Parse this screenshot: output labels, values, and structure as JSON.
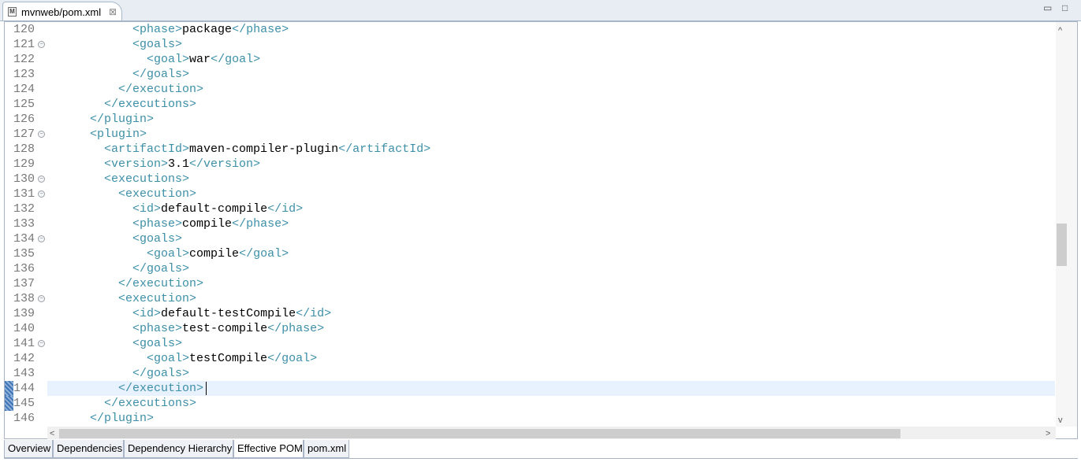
{
  "editor_tab": {
    "icon_letter": "M",
    "title": "mvnweb/pom.xml",
    "close": "⊠"
  },
  "window_controls": {
    "minimize": "▭",
    "maximize": "□"
  },
  "lines": [
    {
      "num": "120",
      "fold": false,
      "indent": 6,
      "segs": [
        [
          "t",
          "<phase>"
        ],
        [
          "x",
          "package"
        ],
        [
          "t",
          "</phase>"
        ]
      ]
    },
    {
      "num": "121",
      "fold": true,
      "indent": 6,
      "segs": [
        [
          "t",
          "<goals>"
        ]
      ]
    },
    {
      "num": "122",
      "fold": false,
      "indent": 7,
      "segs": [
        [
          "t",
          "<goal>"
        ],
        [
          "x",
          "war"
        ],
        [
          "t",
          "</goal>"
        ]
      ]
    },
    {
      "num": "123",
      "fold": false,
      "indent": 6,
      "segs": [
        [
          "t",
          "</goals>"
        ]
      ]
    },
    {
      "num": "124",
      "fold": false,
      "indent": 5,
      "segs": [
        [
          "t",
          "</execution>"
        ]
      ]
    },
    {
      "num": "125",
      "fold": false,
      "indent": 4,
      "segs": [
        [
          "t",
          "</executions>"
        ]
      ]
    },
    {
      "num": "126",
      "fold": false,
      "indent": 3,
      "segs": [
        [
          "t",
          "</plugin>"
        ]
      ]
    },
    {
      "num": "127",
      "fold": true,
      "indent": 3,
      "segs": [
        [
          "t",
          "<plugin>"
        ]
      ]
    },
    {
      "num": "128",
      "fold": false,
      "indent": 4,
      "segs": [
        [
          "t",
          "<artifactId>"
        ],
        [
          "x",
          "maven-compiler-plugin"
        ],
        [
          "t",
          "</artifactId>"
        ]
      ]
    },
    {
      "num": "129",
      "fold": false,
      "indent": 4,
      "segs": [
        [
          "t",
          "<version>"
        ],
        [
          "x",
          "3.1"
        ],
        [
          "t",
          "</version>"
        ]
      ]
    },
    {
      "num": "130",
      "fold": true,
      "indent": 4,
      "segs": [
        [
          "t",
          "<executions>"
        ]
      ]
    },
    {
      "num": "131",
      "fold": true,
      "indent": 5,
      "segs": [
        [
          "t",
          "<execution>"
        ]
      ]
    },
    {
      "num": "132",
      "fold": false,
      "indent": 6,
      "segs": [
        [
          "t",
          "<id>"
        ],
        [
          "x",
          "default-compile"
        ],
        [
          "t",
          "</id>"
        ]
      ]
    },
    {
      "num": "133",
      "fold": false,
      "indent": 6,
      "segs": [
        [
          "t",
          "<phase>"
        ],
        [
          "x",
          "compile"
        ],
        [
          "t",
          "</phase>"
        ]
      ]
    },
    {
      "num": "134",
      "fold": true,
      "indent": 6,
      "segs": [
        [
          "t",
          "<goals>"
        ]
      ]
    },
    {
      "num": "135",
      "fold": false,
      "indent": 7,
      "segs": [
        [
          "t",
          "<goal>"
        ],
        [
          "x",
          "compile"
        ],
        [
          "t",
          "</goal>"
        ]
      ]
    },
    {
      "num": "136",
      "fold": false,
      "indent": 6,
      "segs": [
        [
          "t",
          "</goals>"
        ]
      ]
    },
    {
      "num": "137",
      "fold": false,
      "indent": 5,
      "segs": [
        [
          "t",
          "</execution>"
        ]
      ]
    },
    {
      "num": "138",
      "fold": true,
      "indent": 5,
      "segs": [
        [
          "t",
          "<execution>"
        ]
      ]
    },
    {
      "num": "139",
      "fold": false,
      "indent": 6,
      "segs": [
        [
          "t",
          "<id>"
        ],
        [
          "x",
          "default-testCompile"
        ],
        [
          "t",
          "</id>"
        ]
      ]
    },
    {
      "num": "140",
      "fold": false,
      "indent": 6,
      "segs": [
        [
          "t",
          "<phase>"
        ],
        [
          "x",
          "test-compile"
        ],
        [
          "t",
          "</phase>"
        ]
      ]
    },
    {
      "num": "141",
      "fold": true,
      "indent": 6,
      "segs": [
        [
          "t",
          "<goals>"
        ]
      ]
    },
    {
      "num": "142",
      "fold": false,
      "indent": 7,
      "segs": [
        [
          "t",
          "<goal>"
        ],
        [
          "x",
          "testCompile"
        ],
        [
          "t",
          "</goal>"
        ]
      ]
    },
    {
      "num": "143",
      "fold": false,
      "indent": 6,
      "segs": [
        [
          "t",
          "</goals>"
        ]
      ]
    },
    {
      "num": "144",
      "fold": false,
      "indent": 5,
      "segs": [
        [
          "t",
          "</execution>"
        ]
      ],
      "current": true
    },
    {
      "num": "145",
      "fold": false,
      "indent": 4,
      "segs": [
        [
          "t",
          "</executions>"
        ]
      ]
    },
    {
      "num": "146",
      "fold": false,
      "indent": 3,
      "segs": [
        [
          "t",
          "</plugin>"
        ]
      ]
    }
  ],
  "scroll": {
    "up": "^",
    "down": "v",
    "left": "<",
    "right": ">"
  },
  "page_tabs": [
    {
      "label": "Overview",
      "active": false
    },
    {
      "label": "Dependencies",
      "active": false
    },
    {
      "label": "Dependency Hierarchy",
      "active": false
    },
    {
      "label": "Effective POM",
      "active": true
    },
    {
      "label": "pom.xml",
      "active": false
    }
  ],
  "colors": {
    "tag": "#3d8fa7",
    "text": "#000000",
    "line_number": "#787878",
    "current_line": "#e8f2fe"
  }
}
